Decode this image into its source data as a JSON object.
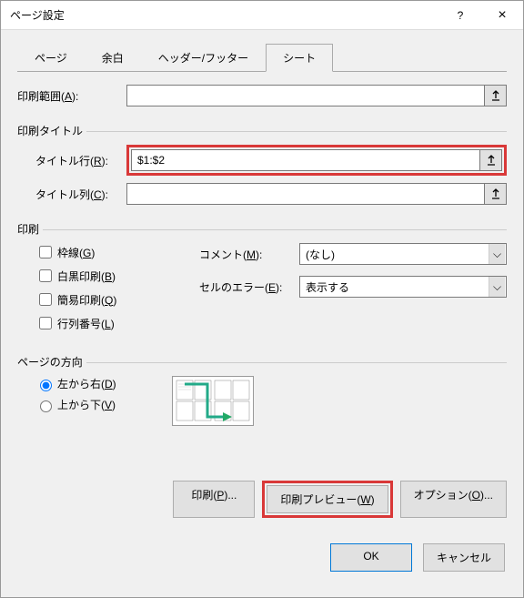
{
  "titlebar": {
    "title": "ページ設定",
    "help": "?",
    "close": "×"
  },
  "tabs": {
    "page": "ページ",
    "margins": "余白",
    "headerfooter": "ヘッダー/フッター",
    "sheet": "シート"
  },
  "printarea": {
    "label_pre": "印刷範囲(",
    "label_u": "A",
    "label_post": "):",
    "value": ""
  },
  "titles": {
    "group": "印刷タイトル",
    "rows_pre": "タイトル行(",
    "rows_u": "R",
    "rows_post": "):",
    "rows_value": "$1:$2",
    "cols_pre": "タイトル列(",
    "cols_u": "C",
    "cols_post": "):",
    "cols_value": ""
  },
  "print": {
    "group": "印刷",
    "grid_pre": "枠線(",
    "grid_u": "G",
    "grid_post": ")",
    "bw_pre": "白黒印刷(",
    "bw_u": "B",
    "bw_post": ")",
    "draft_pre": "簡易印刷(",
    "draft_u": "Q",
    "draft_post": ")",
    "rowcol_pre": "行列番号(",
    "rowcol_u": "L",
    "rowcol_post": ")",
    "comments_pre": "コメント(",
    "comments_u": "M",
    "comments_post": "):",
    "comments_value": "(なし)",
    "errors_pre": "セルのエラー(",
    "errors_u": "E",
    "errors_post": "):",
    "errors_value": "表示する"
  },
  "order": {
    "group": "ページの方向",
    "lr_pre": "左から右(",
    "lr_u": "D",
    "lr_post": ")",
    "tb_pre": "上から下(",
    "tb_u": "V",
    "tb_post": ")"
  },
  "buttons": {
    "print_pre": "印刷(",
    "print_u": "P",
    "print_post": ")...",
    "preview_pre": "印刷プレビュー(",
    "preview_u": "W",
    "preview_post": ")",
    "options_pre": "オプション(",
    "options_u": "O",
    "options_post": ")...",
    "ok": "OK",
    "cancel": "キャンセル"
  }
}
